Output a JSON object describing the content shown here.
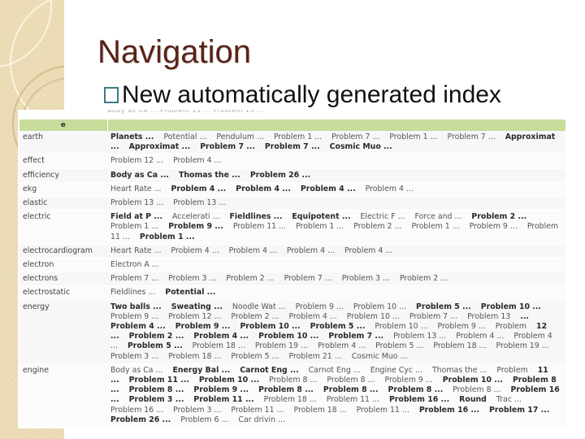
{
  "slide": {
    "title": "Navigation",
    "bullet": "New automatically generated index"
  },
  "index": {
    "header_letter": "e",
    "cutoff_row": "Body as Ca ...  Problem 13 ...  Problem 13 ...",
    "rows": [
      {
        "term": "earth",
        "links": [
          {
            "t": "Planets ...",
            "b": true
          },
          {
            "t": "Potential ...",
            "b": false
          },
          {
            "t": "Pendulum ...",
            "b": false
          },
          {
            "t": "Problem 1 ...",
            "b": false
          },
          {
            "t": "Problem 7 ...",
            "b": false
          },
          {
            "t": "Problem 1 ...",
            "b": false
          },
          {
            "t": "Problem 7 ...",
            "b": false
          },
          {
            "t": "Approximat ...",
            "b": true
          },
          {
            "t": "Approximat ...",
            "b": true
          },
          {
            "t": "Problem 7 ...",
            "b": true
          },
          {
            "t": "Problem 7 ...",
            "b": true
          },
          {
            "t": "Cosmic Muo ...",
            "b": true
          }
        ]
      },
      {
        "term": "effect",
        "links": [
          {
            "t": "Problem 12 ...",
            "b": false
          },
          {
            "t": "Problem 4 ...",
            "b": false
          }
        ]
      },
      {
        "term": "efficiency",
        "links": [
          {
            "t": "Body as Ca ...",
            "b": true
          },
          {
            "t": "Thomas the ...",
            "b": true
          },
          {
            "t": "Problem 26 ...",
            "b": true
          }
        ]
      },
      {
        "term": "ekg",
        "links": [
          {
            "t": "Heart Rate ...",
            "b": false
          },
          {
            "t": "Problem 4 ...",
            "b": true
          },
          {
            "t": "Problem 4 ...",
            "b": true
          },
          {
            "t": "Problem 4 ...",
            "b": true
          },
          {
            "t": "Problem 4 ...",
            "b": false
          }
        ]
      },
      {
        "term": "elastic",
        "links": [
          {
            "t": "Problem 13 ...",
            "b": false
          },
          {
            "t": "Problem 13 ...",
            "b": false
          }
        ]
      },
      {
        "term": "electric",
        "links": [
          {
            "t": "Field at P ...",
            "b": true
          },
          {
            "t": "Accelerati ...",
            "b": false
          },
          {
            "t": "Fieldlines ...",
            "b": true
          },
          {
            "t": "Equipotent ...",
            "b": true
          },
          {
            "t": "Electric F ...",
            "b": false
          },
          {
            "t": "Force and ...",
            "b": false
          },
          {
            "t": "Problem 2 ...",
            "b": true
          },
          {
            "t": "Problem 1 ...",
            "b": false
          },
          {
            "t": "Problem 9 ...",
            "b": true
          },
          {
            "t": "Problem 11 ...",
            "b": false
          },
          {
            "t": "Problem 1 ...",
            "b": false
          },
          {
            "t": "Problem 2 ...",
            "b": false
          },
          {
            "t": "Problem 1 ...",
            "b": false
          },
          {
            "t": "Problem 9 ...",
            "b": false
          },
          {
            "t": "Problem 11 ...",
            "b": false
          },
          {
            "t": "Problem 1 ...",
            "b": true
          }
        ]
      },
      {
        "term": "electrocardiogram",
        "links": [
          {
            "t": "Heart Rate ...",
            "b": false
          },
          {
            "t": "Problem 4 ...",
            "b": false
          },
          {
            "t": "Problem 4 ...",
            "b": false
          },
          {
            "t": "Problem 4 ...",
            "b": false
          },
          {
            "t": "Problem 4 ...",
            "b": false
          }
        ]
      },
      {
        "term": "electron",
        "links": [
          {
            "t": "Electron A ...",
            "b": false
          }
        ]
      },
      {
        "term": "electrons",
        "links": [
          {
            "t": "Problem 7 ...",
            "b": false
          },
          {
            "t": "Problem 3 ...",
            "b": false
          },
          {
            "t": "Problem 2 ...",
            "b": false
          },
          {
            "t": "Problem 7 ...",
            "b": false
          },
          {
            "t": "Problem 3 ...",
            "b": false
          },
          {
            "t": "Problem 2 ...",
            "b": false
          }
        ]
      },
      {
        "term": "electrostatic",
        "links": [
          {
            "t": "Fieldlines ...",
            "b": false
          },
          {
            "t": "Potential ...",
            "b": true
          }
        ]
      },
      {
        "term": "energy",
        "links": [
          {
            "t": "Two balls ...",
            "b": true
          },
          {
            "t": "Sweating ...",
            "b": true
          },
          {
            "t": "Noodle Wat ...",
            "b": false
          },
          {
            "t": "Problem 9 ...",
            "b": false
          },
          {
            "t": "Problem 10 ...",
            "b": false
          },
          {
            "t": "Problem 5 ...",
            "b": true
          },
          {
            "t": "Problem 10 ...",
            "b": true
          },
          {
            "t": "Problem 9 ...",
            "b": false
          },
          {
            "t": "Problem 12 ...",
            "b": false
          },
          {
            "t": "Problem 2 ...",
            "b": false
          },
          {
            "t": "Problem 4 ...",
            "b": false
          },
          {
            "t": "Problem 10 ...",
            "b": false
          },
          {
            "t": "Problem 7 ...",
            "b": false
          },
          {
            "t": "Problem 13",
            "b": false
          },
          {
            "t": "... Problem 4 ...",
            "b": true
          },
          {
            "t": "Problem 9 ...",
            "b": true
          },
          {
            "t": "Problem 10 ...",
            "b": true
          },
          {
            "t": "Problem 5 ...",
            "b": true
          },
          {
            "t": "Problem 10 ...",
            "b": false
          },
          {
            "t": "Problem 9 ...",
            "b": false
          },
          {
            "t": "Problem",
            "b": false
          },
          {
            "t": "12 ...",
            "b": true
          },
          {
            "t": "Problem 2 ...",
            "b": true
          },
          {
            "t": "Problem 4 ...",
            "b": true
          },
          {
            "t": "Problem 10 ...",
            "b": true
          },
          {
            "t": "Problem 7 ...",
            "b": true
          },
          {
            "t": "Problem 13 ...",
            "b": false
          },
          {
            "t": "Problem 4 ...",
            "b": false
          },
          {
            "t": "Problem 4 ...",
            "b": false
          },
          {
            "t": "Problem 5 ...",
            "b": true
          },
          {
            "t": "Problem 18 ...",
            "b": false
          },
          {
            "t": "Problem 19 ...",
            "b": false
          },
          {
            "t": "Problem 4 ...",
            "b": false
          },
          {
            "t": "Problem 5 ...",
            "b": false
          },
          {
            "t": "Problem 18 ...",
            "b": false
          },
          {
            "t": "Problem 19 ...",
            "b": false
          },
          {
            "t": "Problem 3 ...",
            "b": false
          },
          {
            "t": "Problem 18 ...",
            "b": false
          },
          {
            "t": "Problem 5 ...",
            "b": false
          },
          {
            "t": "Problem 21 ...",
            "b": false
          },
          {
            "t": "Cosmic Muo ...",
            "b": false
          }
        ]
      },
      {
        "term": "engine",
        "links": [
          {
            "t": "Body as Ca ...",
            "b": false
          },
          {
            "t": "Energy Bal ...",
            "b": true
          },
          {
            "t": "Carnot Eng ...",
            "b": true
          },
          {
            "t": "Carnot Eng ...",
            "b": false
          },
          {
            "t": "Engine Cyc ...",
            "b": false
          },
          {
            "t": "Thomas the ...",
            "b": false
          },
          {
            "t": "Problem",
            "b": false
          },
          {
            "t": "11 ...",
            "b": true
          },
          {
            "t": "Problem 11 ...",
            "b": true
          },
          {
            "t": "Problem 10 ...",
            "b": true
          },
          {
            "t": "Problem 8 ...",
            "b": false
          },
          {
            "t": "Problem 8 ...",
            "b": false
          },
          {
            "t": "Problem 9 ...",
            "b": false
          },
          {
            "t": "Problem 10 ...",
            "b": true
          },
          {
            "t": "Problem 8 ...",
            "b": true
          },
          {
            "t": "Problem 8 ...",
            "b": true
          },
          {
            "t": "Problem 9 ...",
            "b": true
          },
          {
            "t": "Problem 8 ...",
            "b": true
          },
          {
            "t": "Problem 8 ...",
            "b": true
          },
          {
            "t": "Problem 8 ...",
            "b": true
          },
          {
            "t": "Problem 8 ...",
            "b": false
          },
          {
            "t": "Problem 16 ...",
            "b": true
          },
          {
            "t": "Problem 3 ...",
            "b": true
          },
          {
            "t": "Problem 11 ...",
            "b": true
          },
          {
            "t": "Problem 18 ...",
            "b": false
          },
          {
            "t": "Problem 11 ...",
            "b": false
          },
          {
            "t": "Problem 16 ...",
            "b": true
          },
          {
            "t": "Round",
            "b": true
          },
          {
            "t": "Trac ...",
            "b": false
          },
          {
            "t": "Problem 16 ...",
            "b": false
          },
          {
            "t": "Problem 3 ...",
            "b": false
          },
          {
            "t": "Problem 11 ...",
            "b": false
          },
          {
            "t": "Problem 18 ...",
            "b": false
          },
          {
            "t": "Problem 11 ...",
            "b": false
          },
          {
            "t": "Problem 16 ...",
            "b": true
          },
          {
            "t": "Problem 17 ...",
            "b": true
          },
          {
            "t": "Problem 26 ...",
            "b": true
          },
          {
            "t": "Problem 6 ...",
            "b": false
          },
          {
            "t": "Car drivin ...",
            "b": false
          }
        ]
      }
    ]
  }
}
